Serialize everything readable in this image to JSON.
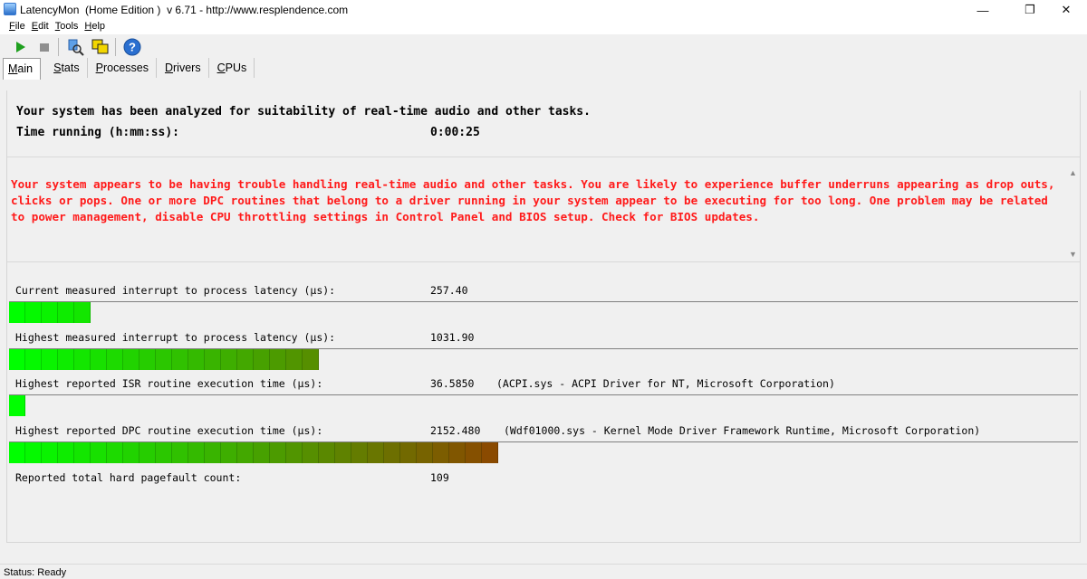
{
  "window": {
    "title": "LatencyMon  (Home Edition )  v 6.71 - http://www.resplendence.com",
    "minimize_glyph": "—",
    "maximize_glyph": "❐",
    "close_glyph": "✕"
  },
  "menu": {
    "items": [
      {
        "mnemonic": "F",
        "rest": "ile"
      },
      {
        "mnemonic": "E",
        "rest": "dit"
      },
      {
        "mnemonic": "T",
        "rest": "ools"
      },
      {
        "mnemonic": "H",
        "rest": "elp"
      }
    ]
  },
  "toolbar": {
    "buttons": [
      {
        "icon": "play-icon",
        "color": "#1fa01f"
      },
      {
        "icon": "stop-icon",
        "color": "#8f8f8f"
      },
      {
        "icon": "driver-scan-icon",
        "color": "#3c7fd6"
      },
      {
        "icon": "windows-icon",
        "color": "#e6c300"
      },
      {
        "icon": "help-icon",
        "color": "#2a6fd0"
      }
    ]
  },
  "tabs": [
    {
      "mnemonic": "M",
      "rest": "ain",
      "active": true
    },
    {
      "mnemonic": "S",
      "rest": "tats",
      "active": false
    },
    {
      "mnemonic": "P",
      "rest": "rocesses",
      "active": false
    },
    {
      "mnemonic": "D",
      "rest": "rivers",
      "active": false
    },
    {
      "mnemonic": "C",
      "rest": "PUs",
      "active": false
    }
  ],
  "summary": {
    "line1": "Your system has been analyzed for suitability of real-time audio and other tasks.",
    "time_label": "Time running (h:mm:ss):",
    "time_value": "0:00:25"
  },
  "warning": {
    "text": "Your system appears to be having trouble handling real-time audio and other tasks. You are likely to experience buffer underruns appearing as drop outs, clicks or pops. One or more DPC routines that belong to a driver running in your system appear to be executing for too long. One problem may be related to power management, disable CPU throttling settings in Control Panel and BIOS setup. Check for BIOS updates.",
    "color": "#ff1a1a"
  },
  "metrics": [
    {
      "label": "Current measured interrupt to process latency (µs):",
      "value": "257.40",
      "extra": "",
      "segments": 5,
      "segment_total": 65
    },
    {
      "label": "Highest measured interrupt to process latency (µs):",
      "value": "1031.90",
      "extra": "",
      "segments": 19,
      "segment_total": 65
    },
    {
      "label": "Highest reported ISR routine execution time (µs):",
      "value": "36.5850",
      "extra": "(ACPI.sys - ACPI Driver for NT, Microsoft Corporation)",
      "segments": 1,
      "segment_total": 65
    },
    {
      "label": "Highest reported DPC routine execution time (µs):",
      "value": "2152.480",
      "extra": "(Wdf01000.sys - Kernel Mode Driver Framework Runtime, Microsoft Corporation)",
      "segments": 30,
      "segment_total": 65
    },
    {
      "label": "Reported total hard pagefault count:",
      "value": "109",
      "extra": "",
      "segments": null,
      "segment_total": null
    }
  ],
  "colors": {
    "gauge_start": "#00ff00",
    "gauge_end": "#8a4a00"
  },
  "status": {
    "text": "Status: Ready"
  }
}
